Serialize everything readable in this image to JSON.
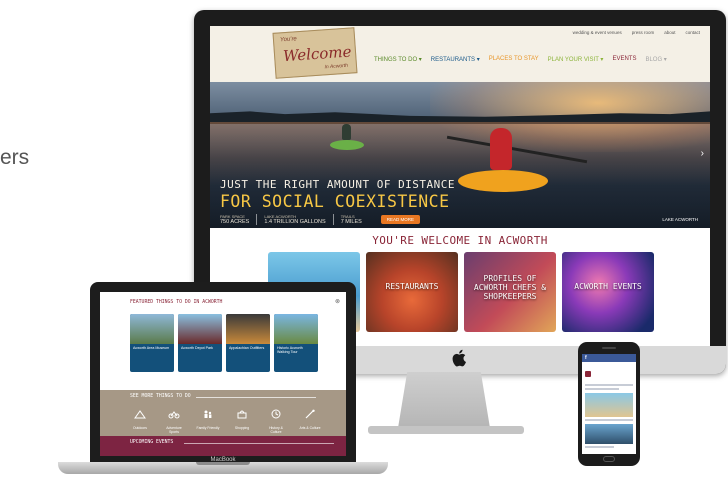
{
  "left_caption": "ers",
  "desktop": {
    "utility_nav": [
      "wedding & event venues",
      "press room",
      "about",
      "contact"
    ],
    "logo": {
      "top": "You're",
      "main": "Welcome",
      "bottom": "In Acworth"
    },
    "main_nav": [
      {
        "label": "THINGS TO DO ▾",
        "color": "#5a8a2a"
      },
      {
        "label": "RESTAURANTS ▾",
        "color": "#1b5a8a"
      },
      {
        "label": "PLACES TO STAY",
        "color": "#e8962a"
      },
      {
        "label": "PLAN YOUR VISIT ▾",
        "color": "#8cb43a"
      },
      {
        "label": "EVENTS",
        "color": "#8a2638"
      },
      {
        "label": "BLOG ▾",
        "color": "#a8a8a8"
      }
    ],
    "hero": {
      "line1": "JUST THE RIGHT AMOUNT OF DISTANCE",
      "line2": "FOR SOCIAL COEXISTENCE",
      "stats": [
        {
          "label": "PARK SPACE",
          "value": "750 ACRES"
        },
        {
          "label": "LAKE ACWORTH",
          "value": "1.4 TRILLION GALLONS"
        },
        {
          "label": "TRAILS",
          "value": "7 MILES"
        }
      ],
      "read_more": "READ MORE",
      "location": "LAKE ACWORTH"
    },
    "welcome_heading": "YOU'RE WELCOME IN ACWORTH",
    "cards": [
      {
        "label": ""
      },
      {
        "label": "RESTAURANTS"
      },
      {
        "label": "PROFILES OF ACWORTH CHEFS & SHOPKEEPERS"
      },
      {
        "label": "ACWORTH EVENTS"
      }
    ]
  },
  "laptop": {
    "featured_title": "FEATURED THINGS TO DO IN ACWORTH",
    "tiles": [
      {
        "text": "Acworth Area Museum"
      },
      {
        "text": "Acworth Depot Park"
      },
      {
        "text": "Appalachian Outfitters"
      },
      {
        "text": "Historic Acworth Walking Tour"
      }
    ],
    "see_more_title": "SEE MORE THINGS TO DO",
    "icons": [
      {
        "name": "outdoor-icon",
        "label": "Outdoors"
      },
      {
        "name": "bike-icon",
        "label": "Adventure Sports"
      },
      {
        "name": "family-icon",
        "label": "Family Friendly"
      },
      {
        "name": "shopping-icon",
        "label": "Shopping"
      },
      {
        "name": "history-icon",
        "label": "History & Culture"
      },
      {
        "name": "arts-icon",
        "label": "Arts & Culture"
      }
    ],
    "upcoming_title": "UPCOMING EVENTS",
    "brand": "MacBook"
  },
  "colors": {
    "brand_maroon": "#8a2638",
    "accent_orange": "#e87722",
    "fb_blue": "#3b5998"
  }
}
